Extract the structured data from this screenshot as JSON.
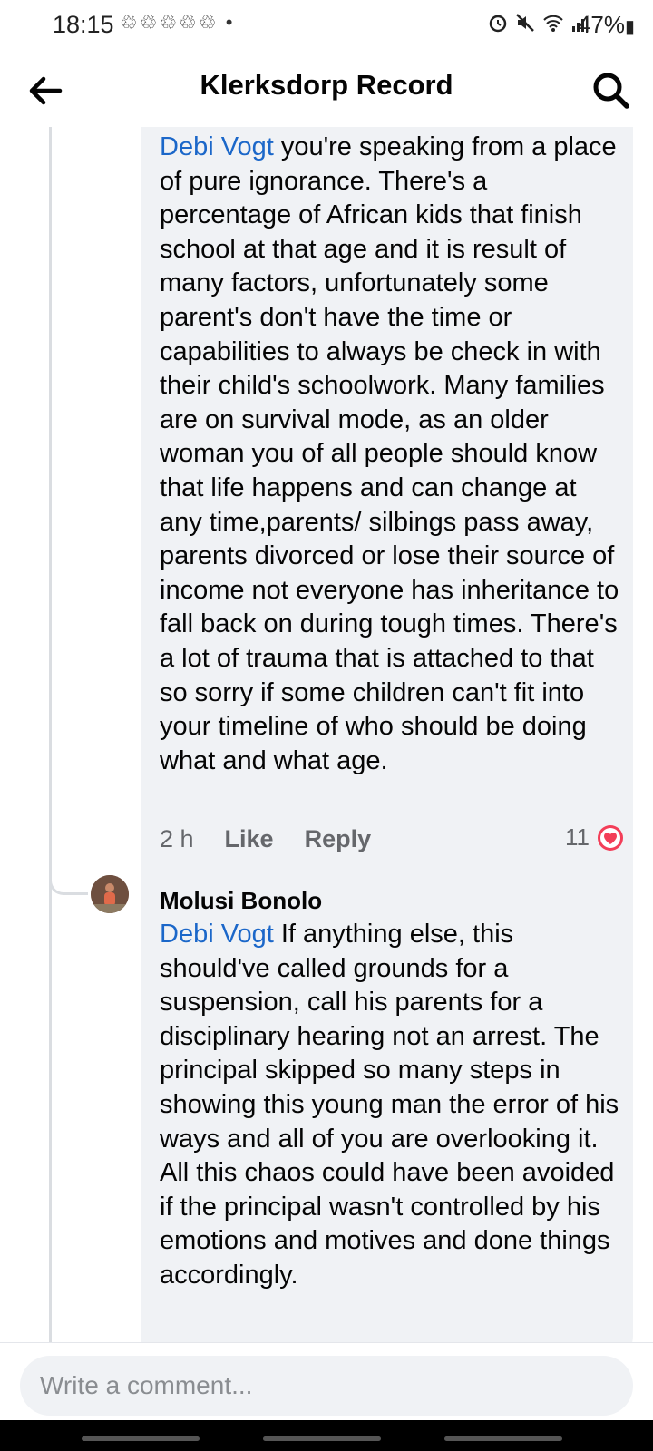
{
  "status": {
    "time": "18:15",
    "notifications": "♲♲♲♲♲ •",
    "battery": "47%"
  },
  "header": {
    "title": "Klerksdorp Record"
  },
  "comments": [
    {
      "mention": "Debi Vogt",
      "text": " you're speaking from a place of pure ignorance. There's a percentage of African kids that finish school at that age and it is  result of many factors, unfortunately some parent's don't have the time or capabilities to always be check in with their child's schoolwork. Many families are on survival mode, as an older woman you of all people should know that life happens and can change at any time,parents/ silbings pass away, parents divorced or lose their source of income not everyone has inheritance to fall back on during tough times. There's a lot of trauma that is attached to that so sorry if some children can't fit into your timeline of who should be doing what and what age.",
      "time": "2 h",
      "like_label": "Like",
      "reply_label": "Reply",
      "reaction_count": "11",
      "reaction_icon": "heart-icon"
    },
    {
      "author": "Molusi Bonolo",
      "mention": "Debi Vogt",
      "text": " If anything else, this should've called grounds for a suspension, call his parents for a disciplinary hearing not an arrest. The principal skipped so many steps in showing this young man the error of his ways and all of you are overlooking it.  All this chaos could have been avoided if the principal wasn't controlled by his emotions and motives and done things accordingly."
    }
  ],
  "composer": {
    "placeholder": "Write a comment..."
  },
  "colors": {
    "mention": "#1b67c9",
    "bubble": "#f0f2f5",
    "heart": "#f33e58"
  }
}
